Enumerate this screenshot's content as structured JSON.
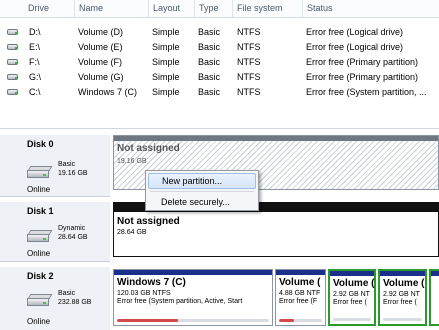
{
  "volume_list": {
    "columns": [
      "Drive",
      "Name",
      "Layout",
      "Type",
      "File system",
      "Status"
    ],
    "rows": [
      {
        "drive": "D:\\",
        "name": "Volume (D)",
        "layout": "Simple",
        "type": "Basic",
        "fs": "NTFS",
        "status": "Error free (Logical drive)"
      },
      {
        "drive": "E:\\",
        "name": "Volume (E)",
        "layout": "Simple",
        "type": "Basic",
        "fs": "NTFS",
        "status": "Error free (Logical drive)"
      },
      {
        "drive": "F:\\",
        "name": "Volume (F)",
        "layout": "Simple",
        "type": "Basic",
        "fs": "NTFS",
        "status": "Error free (Primary partition)"
      },
      {
        "drive": "G:\\",
        "name": "Volume (G)",
        "layout": "Simple",
        "type": "Basic",
        "fs": "NTFS",
        "status": "Error free (Primary partition)"
      },
      {
        "drive": "C:\\",
        "name": "Windows 7 (C)",
        "layout": "Simple",
        "type": "Basic",
        "fs": "NTFS",
        "status": "Error free (System partition, ..."
      }
    ]
  },
  "disks": [
    {
      "name": "Disk 0",
      "kind": "Basic",
      "size": "19.16 GB",
      "status": "Online",
      "partitions": [
        {
          "title": "Not assigned",
          "size": "19.16 GB",
          "info": "",
          "cap_color": "#6f7780",
          "usage": null
        }
      ]
    },
    {
      "name": "Disk 1",
      "kind": "Dynamic",
      "size": "28.64 GB",
      "status": "Online",
      "partitions": [
        {
          "title": "Not assigned",
          "size": "28.64 GB",
          "info": "",
          "cap_color": "#111111",
          "usage": null
        }
      ]
    },
    {
      "name": "Disk 2",
      "kind": "Basic",
      "size": "232.88 GB",
      "status": "Online",
      "partitions": [
        {
          "title": "Windows 7 (C)",
          "size": "120.03 GB NTFS",
          "info": "Error free (System partition, Active, Start",
          "cap_color": "#1a2f8c",
          "usage": 0.4
        },
        {
          "title": "Volume (",
          "size": "4.88 GB NTF",
          "info": "Error free (F",
          "cap_color": "#1a2f8c",
          "usage": 0.35
        },
        {
          "title": "Volume (",
          "size": "2.92 GB NT",
          "info": "Error free (",
          "cap_color": "#1a2f8c",
          "usage": 0.0
        },
        {
          "title": "Volume (",
          "size": "2.92 GB NT",
          "info": "Error free (",
          "cap_color": "#1a2f8c",
          "usage": 0.0
        },
        {
          "title": "",
          "size": "",
          "info": "",
          "cap_color": "#1a2f8c",
          "usage": null
        }
      ]
    }
  ],
  "context_menu": {
    "items": [
      "New partition...",
      "Delete securely..."
    ]
  },
  "colors": {
    "selection_border": "#2a9a2a",
    "usage_fill": "#d24a4a"
  }
}
